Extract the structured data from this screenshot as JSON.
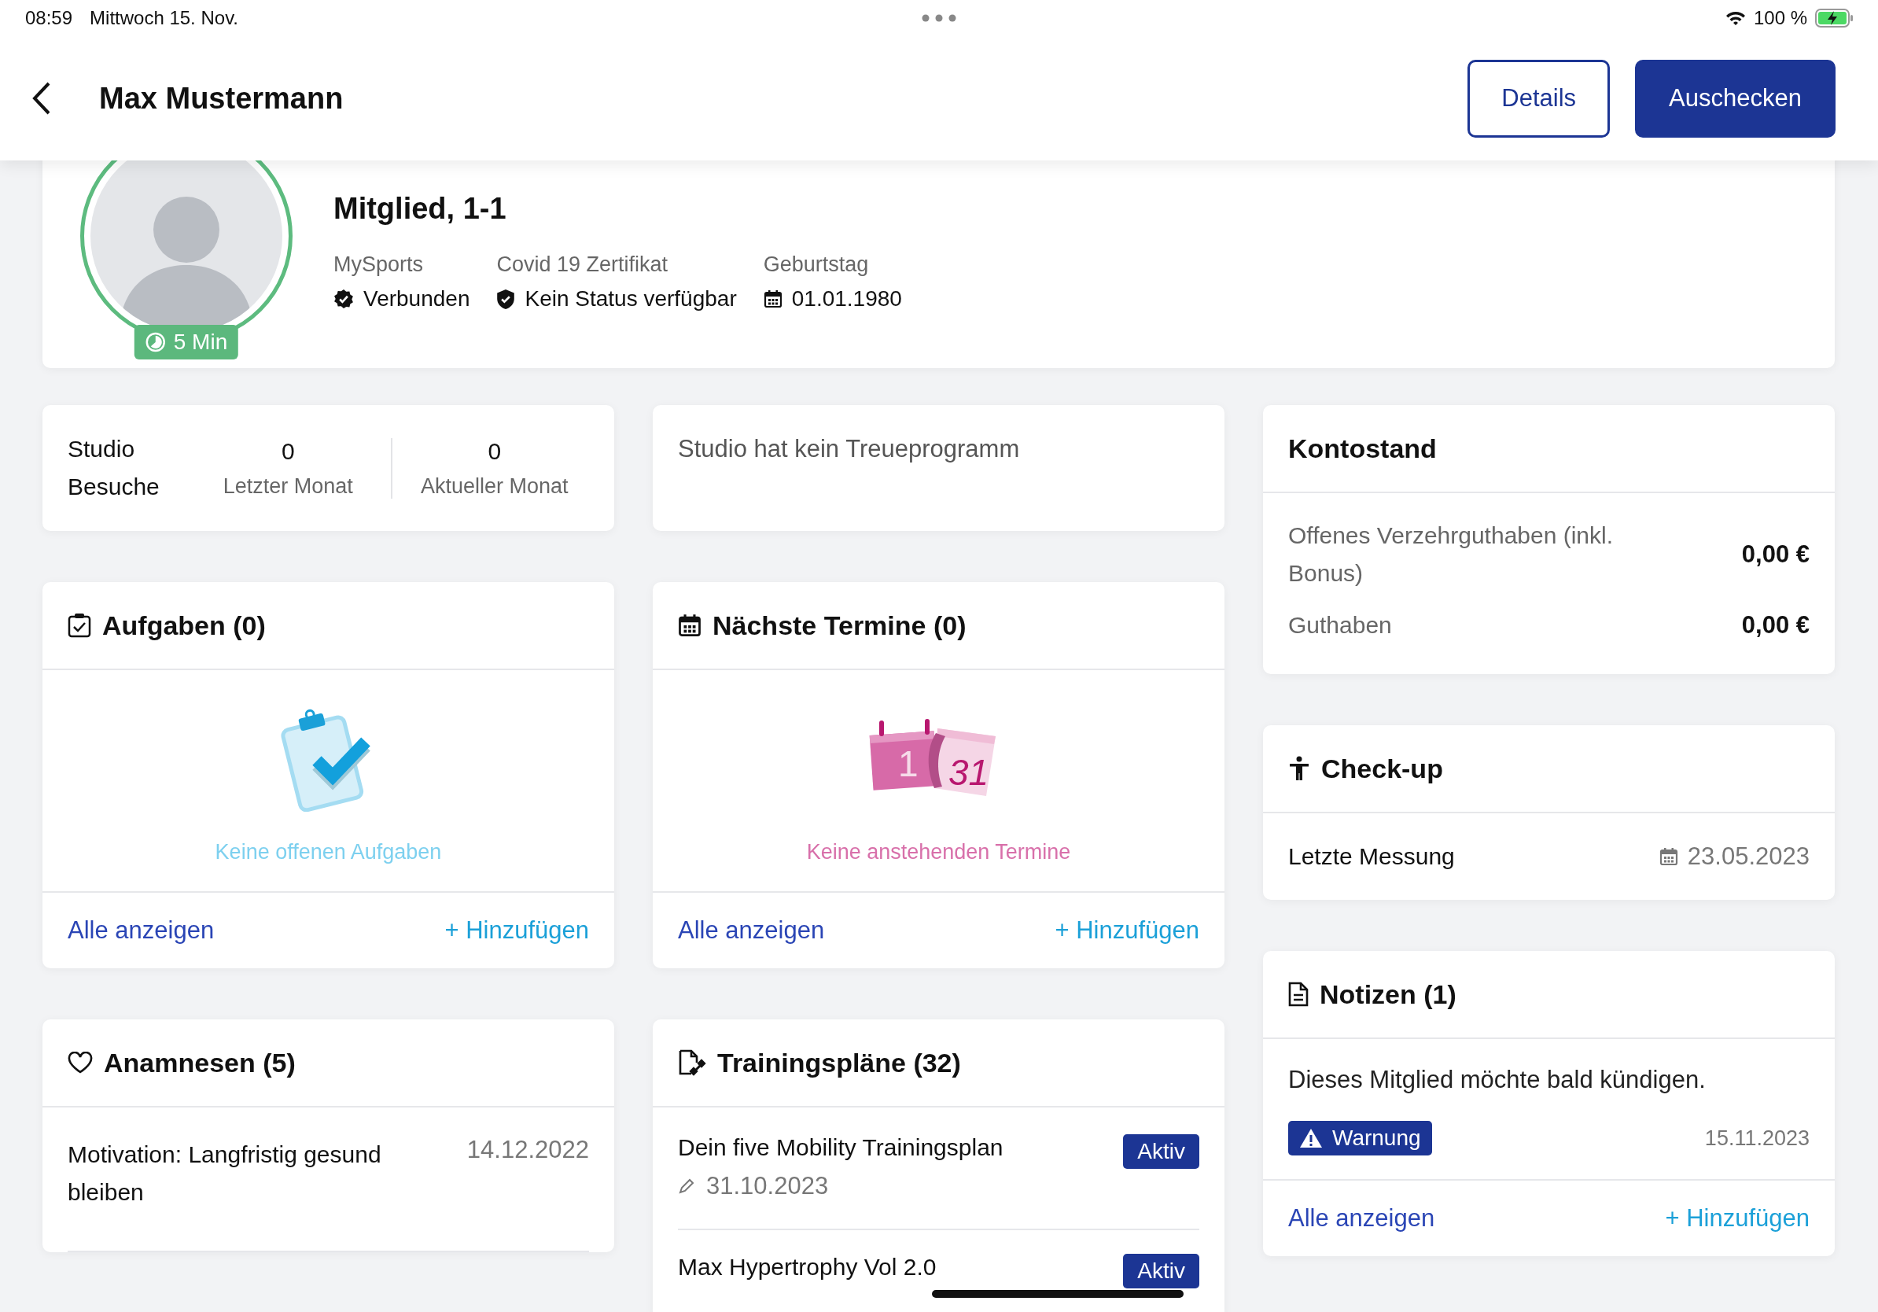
{
  "status_bar": {
    "time": "08:59",
    "date": "Mittwoch 15. Nov.",
    "battery": "100 %"
  },
  "header": {
    "title": "Max Mustermann",
    "buttons": [
      {
        "label": "Details",
        "kind": "outline"
      },
      {
        "label": "Auschecken",
        "kind": "filled"
      }
    ]
  },
  "profile": {
    "badge": "5 Min",
    "membership": "Mitglied, 1-1",
    "facts": [
      {
        "label": "MySports",
        "value": "Verbunden",
        "kind": "verified"
      },
      {
        "label": "Covid 19 Zertifikat",
        "value": "Kein Status verfügbar",
        "kind": "shield"
      },
      {
        "label": "Geburtstag",
        "value": "01.01.1980",
        "kind": "calendar"
      }
    ]
  },
  "visits": {
    "title": "Studio Besuche",
    "stats": [
      {
        "value": "0",
        "label": "Letzter Monat"
      },
      {
        "value": "0",
        "label": "Aktueller Monat"
      }
    ]
  },
  "loyalty": {
    "text": "Studio hat kein Treueprogramm"
  },
  "tasks": {
    "title": "Aufgaben (0)",
    "empty_text": "Keine offenen Aufgaben",
    "all_link": "Alle anzeigen",
    "add_link": "+ Hinzufügen"
  },
  "appointments": {
    "title": "Nächste Termine (0)",
    "illustration_numbers": [
      "1",
      "31"
    ],
    "empty_text": "Keine anstehenden Termine",
    "all_link": "Alle anzeigen",
    "add_link": "+ Hinzufügen"
  },
  "anamneses": {
    "title": "Anamnesen (5)",
    "items": [
      {
        "title": "Motivation: Langfristig gesund bleiben",
        "date": "14.12.2022"
      }
    ]
  },
  "training_plans": {
    "title": "Trainingspläne (32)",
    "items": [
      {
        "title": "Dein five Mobility Trainingsplan",
        "date": "31.10.2023",
        "status": "Aktiv"
      },
      {
        "title": "Max Hypertrophy Vol 2.0",
        "status": "Aktiv"
      }
    ]
  },
  "balance": {
    "title": "Kontostand",
    "rows": [
      {
        "label": "Offenes Verzehrguthaben (inkl. Bonus)",
        "value": "0,00 €"
      },
      {
        "label": "Guthaben",
        "value": "0,00 €"
      }
    ]
  },
  "checkup": {
    "title": "Check-up",
    "rows": [
      {
        "label": "Letzte Messung",
        "date": "23.05.2023"
      }
    ]
  },
  "notes": {
    "title": "Notizen (1)",
    "items": [
      {
        "text": "Dieses Mitglied möchte bald kündigen.",
        "tag": "Warnung",
        "date": "15.11.2023"
      }
    ],
    "all_link": "Alle anzeigen",
    "add_link": "+ Hinzufügen"
  }
}
